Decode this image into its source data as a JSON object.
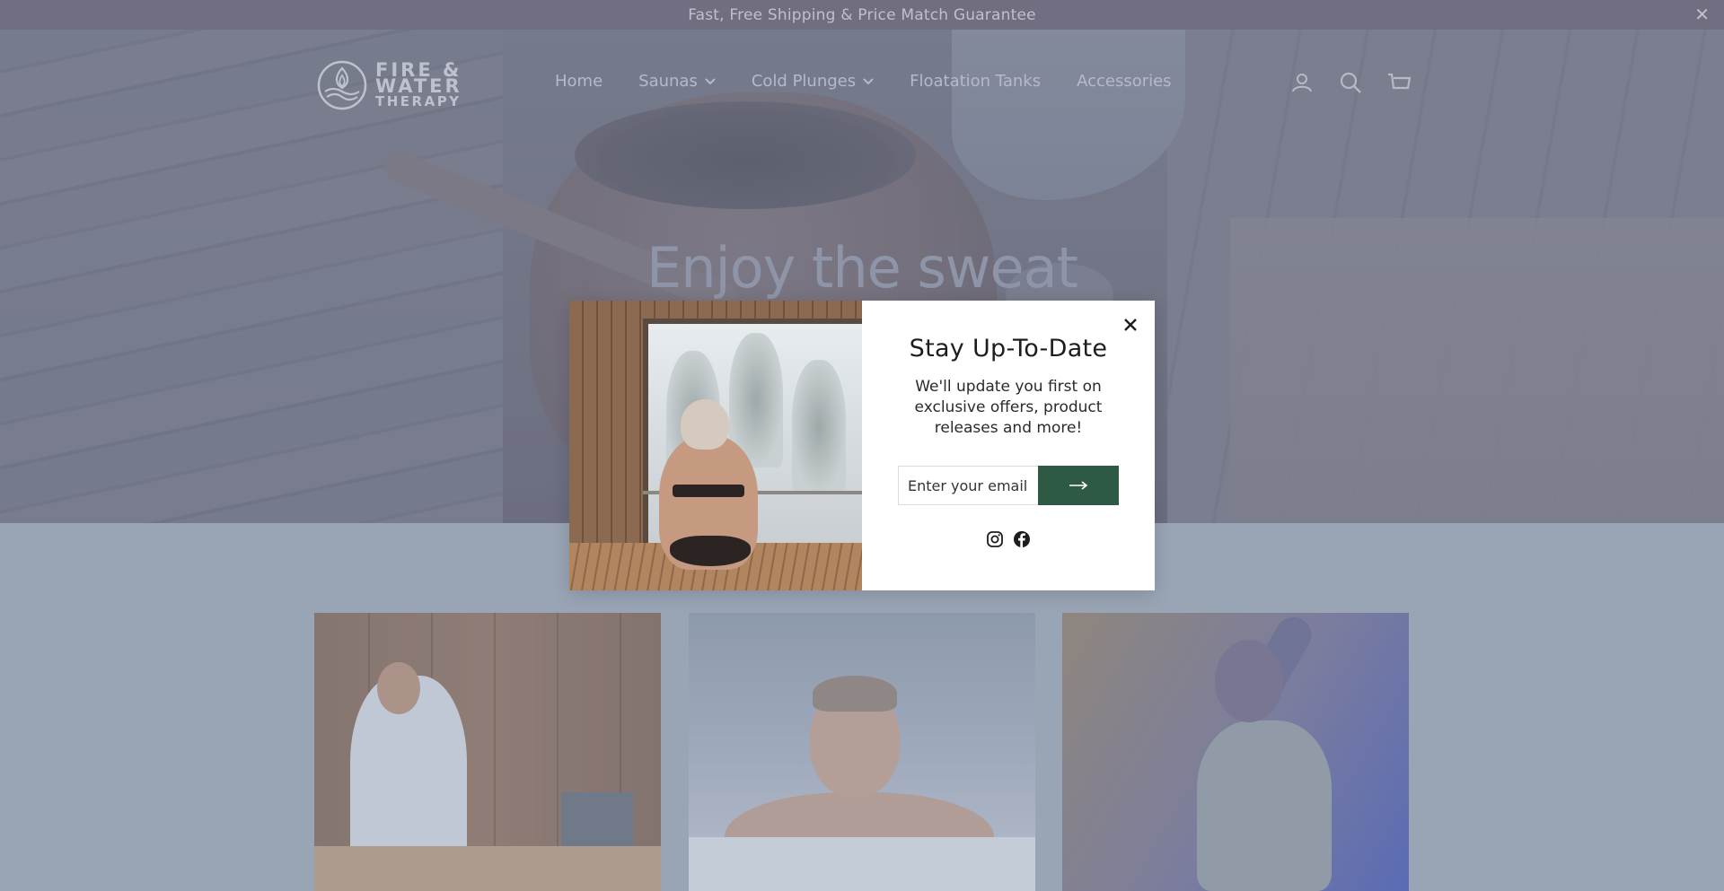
{
  "announcement": {
    "text": "Fast, Free Shipping & Price Match Guarantee",
    "close_icon": "close-icon"
  },
  "brand": {
    "line1": "FIRE &",
    "line2": "WATER",
    "line3": "THERAPY",
    "logo_icon": "water-flame-logo"
  },
  "nav": {
    "items": [
      {
        "label": "Home",
        "dropdown": false
      },
      {
        "label": "Saunas",
        "dropdown": true
      },
      {
        "label": "Cold Plunges",
        "dropdown": true
      },
      {
        "label": "Floatation Tanks",
        "dropdown": false
      },
      {
        "label": "Accessories",
        "dropdown": false
      }
    ],
    "chevron": "⌄"
  },
  "header_icons": [
    "account-icon",
    "search-icon",
    "cart-icon"
  ],
  "hero": {
    "title": "Enjoy the sweat"
  },
  "modal": {
    "title": "Stay Up-To-Date",
    "text": "We'll update you first on exclusive offers, product releases and more!",
    "email_placeholder": "Enter your email",
    "submit_icon": "arrow-right-icon",
    "socials": [
      "instagram-icon",
      "facebook-icon"
    ],
    "close_icon": "close-icon"
  },
  "colors": {
    "announcement_bg": "#5e5466",
    "submit_button": "#2e5945",
    "modal_bg": "#ffffff"
  }
}
